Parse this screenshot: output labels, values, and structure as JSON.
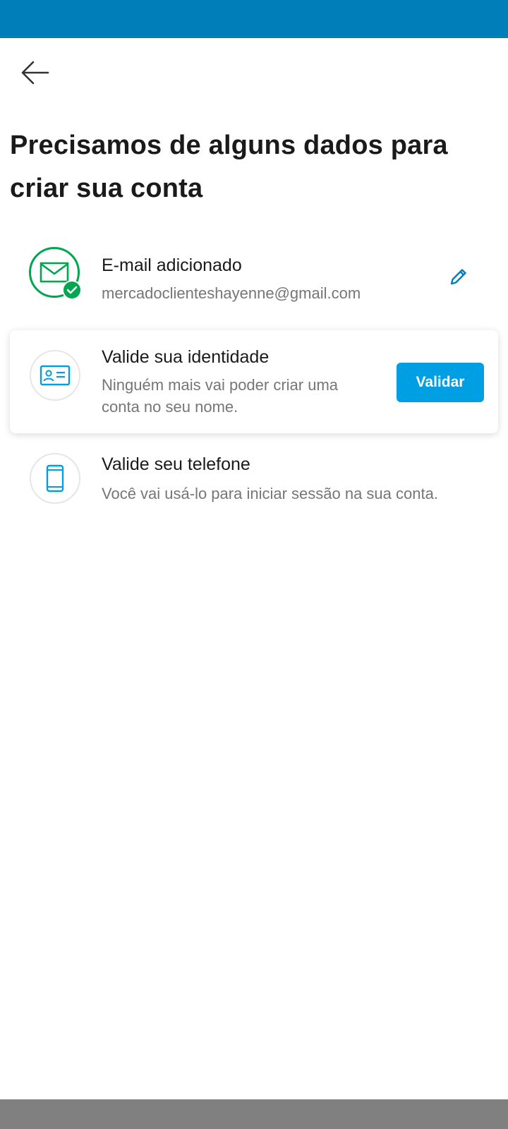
{
  "header": {
    "back_icon": "arrow-left-icon",
    "title": "Precisamos de alguns dados para criar sua conta"
  },
  "steps": [
    {
      "icon": "envelope-icon",
      "status": "completed",
      "title": "E-mail adicionado",
      "description": "mercadoclienteshayenne@gmail.com",
      "action_icon": "pencil-icon"
    },
    {
      "icon": "id-card-icon",
      "status": "pending",
      "title": "Valide sua identidade",
      "description": "Ninguém mais vai poder criar uma conta no seu nome.",
      "button_label": "Validar"
    },
    {
      "icon": "smartphone-icon",
      "status": "pending",
      "title": "Valide seu telefone",
      "description": "Você vai usá-lo para iniciar sessão na sua conta."
    }
  ],
  "colors": {
    "status_bar": "#007eba",
    "success": "#00a650",
    "primary": "#009ee3",
    "icon_blue": "#009ee3",
    "nav_bar": "#808080"
  }
}
